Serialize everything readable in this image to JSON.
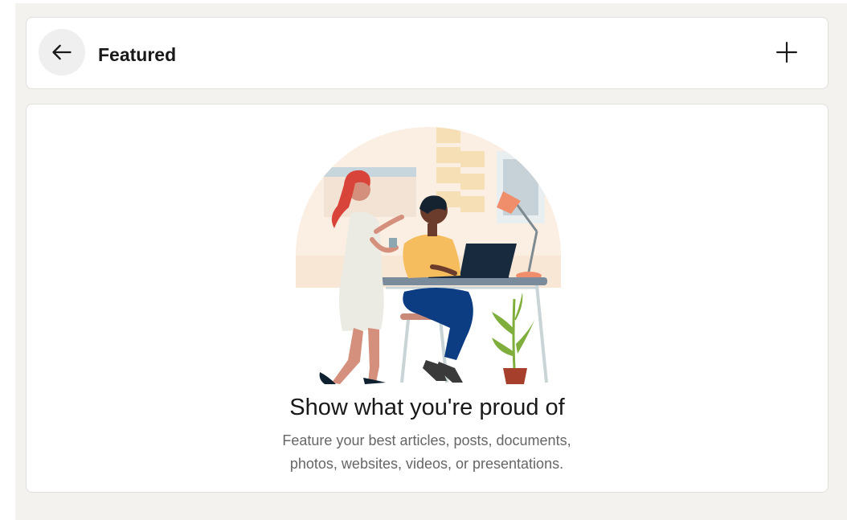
{
  "header": {
    "title": "Featured",
    "back_icon": "arrow-left-icon",
    "add_icon": "plus-icon"
  },
  "empty_state": {
    "headline": "Show what you're proud of",
    "description": "Feature your best articles, posts, documents, photos, websites, videos, or presentations.",
    "illustration": "people-at-desk-illustration"
  },
  "colors": {
    "page_background": "#f3f2ef",
    "card_background": "#ffffff",
    "card_border": "#e0dfdc",
    "text_primary": "#191919",
    "text_secondary": "#666666"
  }
}
